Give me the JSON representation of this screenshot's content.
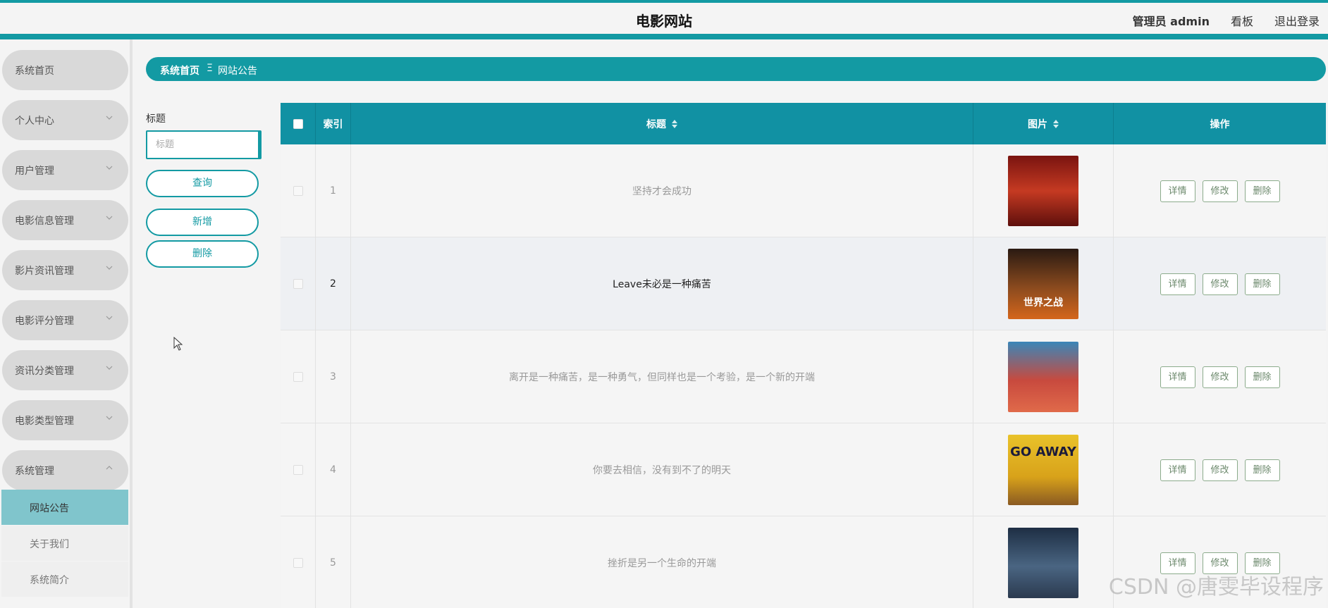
{
  "app": {
    "title": "电影网站",
    "user_label": "管理员",
    "username": "admin",
    "board_link": "看板",
    "logout_link": "退出登录"
  },
  "sidebar": {
    "items": [
      {
        "label": "系统首页"
      },
      {
        "label": "个人中心"
      },
      {
        "label": "用户管理"
      },
      {
        "label": "电影信息管理"
      },
      {
        "label": "影片资讯管理"
      },
      {
        "label": "电影评分管理"
      },
      {
        "label": "资讯分类管理"
      },
      {
        "label": "电影类型管理"
      },
      {
        "label": "系统管理"
      }
    ],
    "submenu": [
      {
        "label": "网站公告"
      },
      {
        "label": "关于我们"
      },
      {
        "label": "系统简介"
      }
    ]
  },
  "breadcrumb": {
    "home": "系统首页",
    "separator": "Ξ",
    "current": "网站公告"
  },
  "search": {
    "label": "标题",
    "placeholder": "标题",
    "query_button": "查询",
    "add_button": "新增",
    "delete_button": "删除"
  },
  "table": {
    "headers": {
      "index": "索引",
      "title": "标题",
      "image": "图片",
      "actions": "操作"
    },
    "rows": [
      {
        "index": "1",
        "title": "坚持才会成功",
        "poster_color": "#b8281e",
        "poster_text": "",
        "details": "详情",
        "edit": "修改",
        "delete": "删除"
      },
      {
        "index": "2",
        "title": "Leave未必是一种痛苦",
        "poster_color": "#6b3a1c",
        "poster_text": "世界之战",
        "details": "详情",
        "edit": "修改",
        "delete": "删除"
      },
      {
        "index": "3",
        "title": "离开是一种痛苦，是一种勇气，但同样也是一个考验，是一个新的开端",
        "poster_color": "#c9463a",
        "poster_text": "",
        "details": "详情",
        "edit": "修改",
        "delete": "删除"
      },
      {
        "index": "4",
        "title": "你要去相信，没有到不了的明天",
        "poster_color": "#e2b41f",
        "poster_text": "GO AWAY",
        "details": "详情",
        "edit": "修改",
        "delete": "删除"
      },
      {
        "index": "5",
        "title": "挫折是另一个生命的开端",
        "poster_color": "#2d4566",
        "poster_text": "",
        "details": "详情",
        "edit": "修改",
        "delete": "删除"
      }
    ]
  },
  "watermark": "CSDN @唐雯毕设程序",
  "colors": {
    "accent": "#139aa3",
    "header_table": "#1191a3",
    "active_submenu": "#80c5cc"
  }
}
